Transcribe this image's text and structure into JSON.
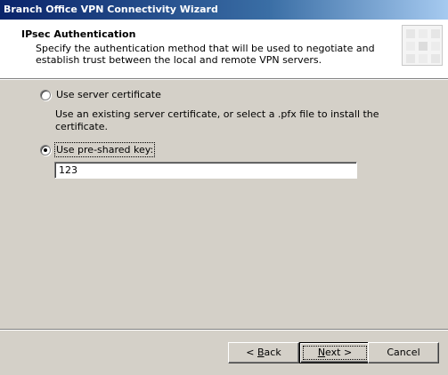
{
  "window": {
    "title": "Branch Office VPN Connectivity Wizard"
  },
  "header": {
    "title": "IPsec Authentication",
    "description": "Specify the authentication method that will be used to negotiate and establish trust between the local and remote VPN servers."
  },
  "options": {
    "server_certificate": {
      "label": "Use server certificate",
      "selected": false,
      "description": "Use an existing server certificate, or select a .pfx file to install the certificate."
    },
    "pre_shared_key": {
      "label": "Use pre-shared key:",
      "selected": true,
      "value": "123"
    }
  },
  "buttons": {
    "back_prefix": "< ",
    "back_mnemonic": "B",
    "back_rest": "ack",
    "next_mnemonic": "N",
    "next_rest": "ext",
    "next_suffix": " >",
    "cancel": "Cancel"
  },
  "colors": {
    "face": "#d4d0c8",
    "title_start": "#0a246a",
    "title_end": "#a6caf0",
    "header_bg": "#ffffff"
  }
}
